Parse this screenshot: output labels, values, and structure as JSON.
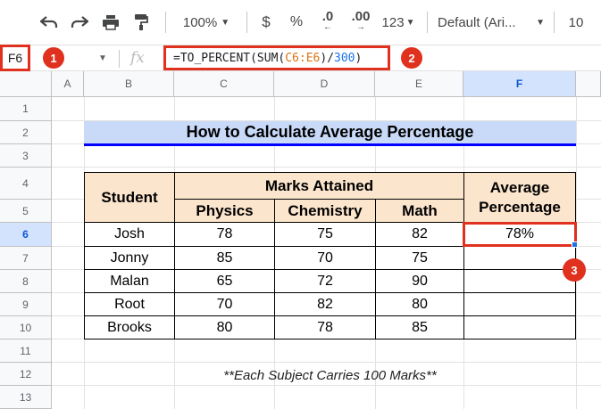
{
  "toolbar": {
    "undo_icon": "undo-icon",
    "redo_icon": "redo-icon",
    "print_icon": "print-icon",
    "paint_format_icon": "paint-format-icon",
    "zoom": "100%",
    "currency": "$",
    "percent": "%",
    "decrease_decimal": ".0",
    "increase_decimal": ".00",
    "more_formats": "123",
    "font_family": "Default (Ari...",
    "font_size": "10"
  },
  "formula_bar": {
    "name_box": "F6",
    "fx": "fx",
    "formula_prefix": "=TO_PERCENT(SUM(",
    "formula_range": "C6:E6",
    "formula_mid": ")/",
    "formula_divisor": "300",
    "formula_suffix": ")"
  },
  "badges": [
    "1",
    "2",
    "3"
  ],
  "columns": [
    "A",
    "B",
    "C",
    "D",
    "E",
    "F"
  ],
  "rows": [
    "1",
    "2",
    "3",
    "4",
    "5",
    "6",
    "7",
    "8",
    "9",
    "10",
    "11",
    "12",
    "13"
  ],
  "sheet": {
    "title": "How to Calculate Average Percentage",
    "headers": {
      "student": "Student",
      "marks_attained": "Marks Attained",
      "physics": "Physics",
      "chemistry": "Chemistry",
      "math": "Math",
      "average_line1": "Average",
      "average_line2": "Percentage"
    },
    "data": [
      [
        "Josh",
        "78",
        "75",
        "82",
        "78%"
      ],
      [
        "Jonny",
        "85",
        "70",
        "75",
        ""
      ],
      [
        "Malan",
        "65",
        "72",
        "90",
        ""
      ],
      [
        "Root",
        "70",
        "82",
        "80",
        ""
      ],
      [
        "Brooks",
        "80",
        "78",
        "85",
        ""
      ]
    ],
    "note": "**Each Subject Carries 100 Marks**"
  },
  "colors": {
    "highlight_red": "#e0301e",
    "title_bg": "#c9daf8",
    "title_underline": "#0000ff",
    "header_bg": "#fce5cd",
    "selection_blue": "#d3e3fd"
  }
}
